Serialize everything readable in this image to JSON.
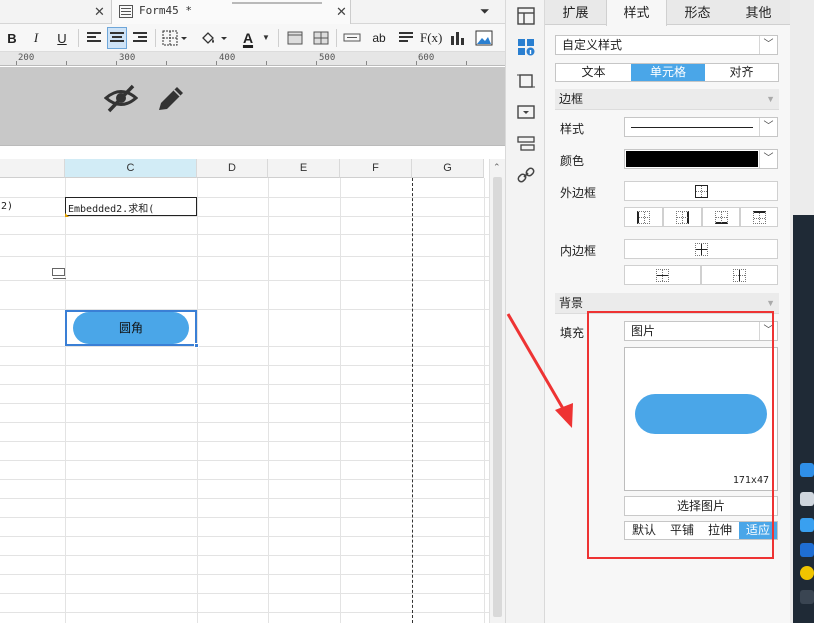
{
  "tabs": {
    "close_glyph": "✕",
    "active_title": "Form45 *",
    "menu_glyph": "⏷"
  },
  "toolbar": {
    "bold": "B",
    "italic": "I",
    "underline": "U",
    "font_color_letter": "A",
    "text_label": "ab",
    "formula": "F(x)"
  },
  "ruler": {
    "ticks": [
      "200",
      "300",
      "400",
      "500",
      "600"
    ]
  },
  "sheet": {
    "columns": [
      "C",
      "D",
      "E",
      "F",
      "G"
    ],
    "row_text_left": "2)",
    "row_text_main": "Embedded2.求和(",
    "button_label": "圆角"
  },
  "panel": {
    "tabs": [
      "扩展",
      "样式",
      "形态",
      "其他"
    ],
    "active_tab": "样式",
    "style_select": "自定义样式",
    "subtabs": [
      "文本",
      "单元格",
      "对齐"
    ],
    "active_subtab": "单元格",
    "border_section": "边框",
    "border_style_label": "样式",
    "border_color_label": "颜色",
    "border_color": "#000000",
    "outer_border_label": "外边框",
    "inner_border_label": "内边框",
    "background_section": "背景",
    "fill_label": "填充",
    "fill_value": "图片",
    "preview_size": "171x47",
    "choose_image_button": "选择图片",
    "fit_modes": [
      "默认",
      "平铺",
      "拉伸",
      "适应"
    ],
    "active_fit_mode": "适应"
  },
  "colors": {
    "accent": "#4aa6e8",
    "selection": "#3a7fd5",
    "annotation": "#e33333"
  }
}
